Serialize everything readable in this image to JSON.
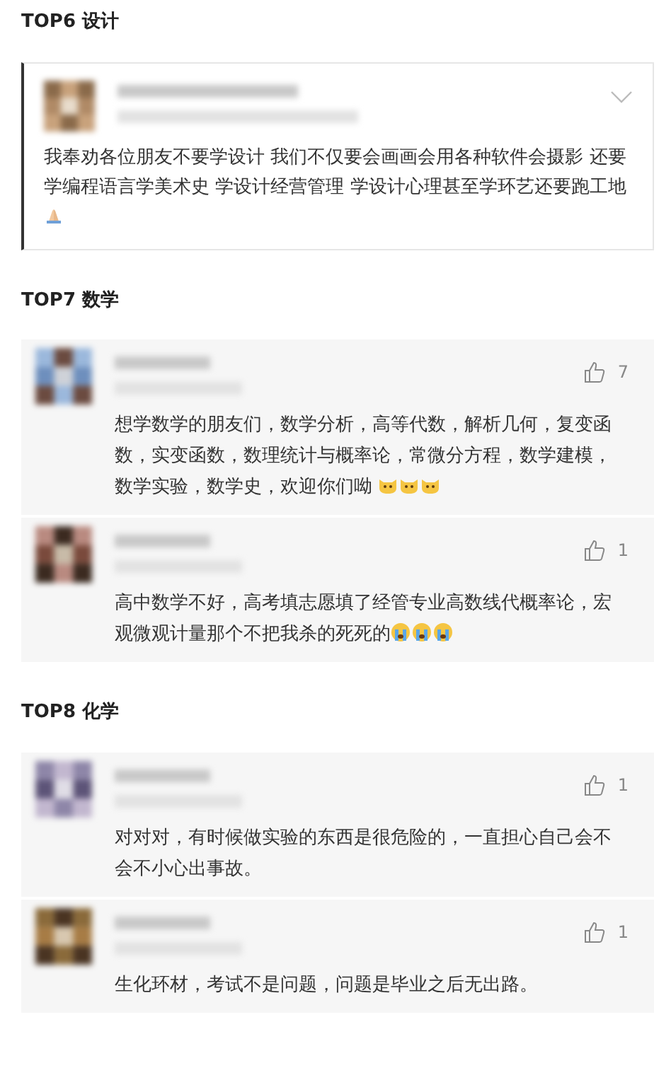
{
  "sections": [
    {
      "title": "TOP6 设计",
      "kind": "post",
      "comments": [
        {
          "text": "我奉劝各位朋友不要学设计 我们不仅要会画画会用各种软件会摄影 还要学编程语言学美术史 学设计经营管理 学设计心理甚至学环艺还要跑工地",
          "emojis": [
            {
              "kind": "pray"
            }
          ]
        }
      ]
    },
    {
      "title": "TOP7 数学",
      "kind": "reply",
      "comments": [
        {
          "likes": "7",
          "text": "想学数学的朋友们，数学分析，高等代数，解析几何，复变函数，实变函数，数理统计与概率论，常微分方程，数学建模，数学实验，数学史，欢迎你们呦 ",
          "emojis": [
            {
              "kind": "cat"
            },
            {
              "kind": "cat"
            },
            {
              "kind": "cat"
            }
          ]
        },
        {
          "likes": "1",
          "text": "高中数学不好，高考填志愿填了经管专业高数线代概率论，宏观微观计量那个不把我杀的死死的",
          "emojis": [
            {
              "kind": "cry"
            },
            {
              "kind": "cry"
            },
            {
              "kind": "cry"
            }
          ]
        }
      ]
    },
    {
      "title": "TOP8 化学",
      "kind": "reply",
      "comments": [
        {
          "likes": "1",
          "text": "对对对，有时候做实验的东西是很危险的，一直担心自己会不会不小心出事故。"
        },
        {
          "likes": "1",
          "text": "生化环材，考试不是问题，问题是毕业之后无出路。"
        }
      ]
    }
  ]
}
